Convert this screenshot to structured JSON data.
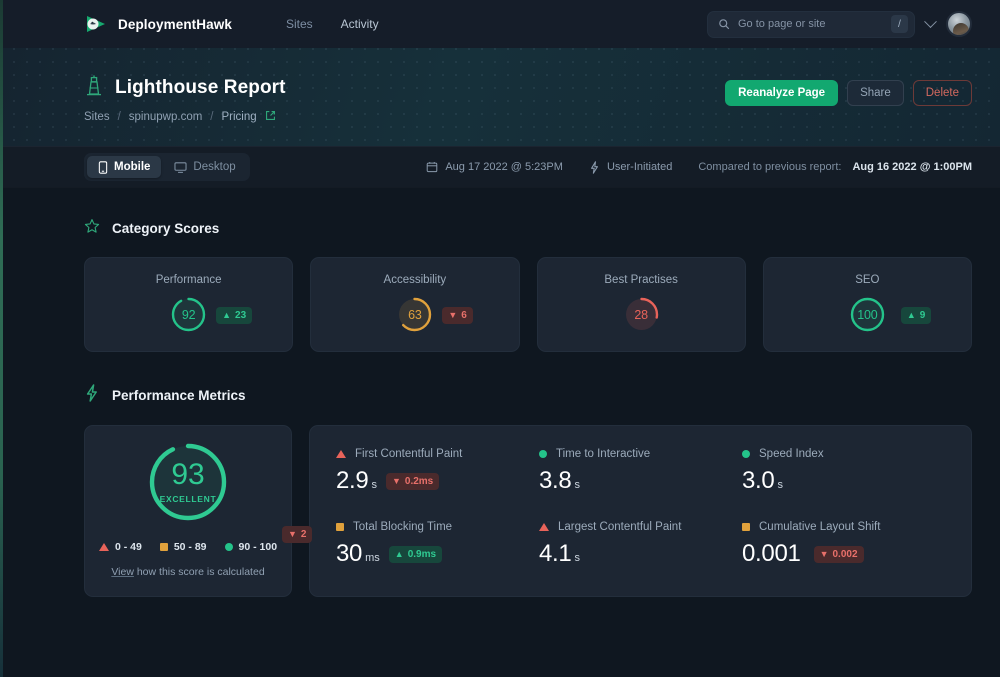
{
  "brand": {
    "name": "DeploymentHawk",
    "logo_icon": "hawk-logo-icon"
  },
  "nav": {
    "items": [
      {
        "label": "Sites"
      },
      {
        "label": "Activity"
      }
    ]
  },
  "search": {
    "placeholder": "Go to page or site",
    "shortcut": "/",
    "icon": "search-icon"
  },
  "account": {
    "chevron_icon": "chevron-down-icon",
    "avatar_icon": "user-avatar"
  },
  "hero": {
    "icon": "lighthouse-icon",
    "title": "Lighthouse Report",
    "breadcrumb": {
      "root": "Sites",
      "site": "spinupwp.com",
      "page": "Pricing",
      "sep": "/",
      "external_icon": "external-link-icon"
    },
    "actions": {
      "reanalyze": "Reanalyze Page",
      "share": "Share",
      "delete": "Delete"
    }
  },
  "toolbar": {
    "devices": [
      {
        "label": "Mobile",
        "icon": "mobile-icon",
        "active": true
      },
      {
        "label": "Desktop",
        "icon": "desktop-icon",
        "active": false
      }
    ],
    "date": "Aug 17 2022 @ 5:23PM",
    "date_icon": "calendar-icon",
    "trigger": "User-Initiated",
    "trigger_icon": "bolt-icon",
    "compare_label": "Compared to previous report:",
    "compare_date": "Aug 16 2022 @ 1:00PM"
  },
  "category_scores": {
    "heading": "Category Scores",
    "heading_icon": "star-icon",
    "cards": [
      {
        "label": "Performance",
        "score": 92,
        "color": "#24c38a",
        "delta": 23,
        "delta_dir": "up"
      },
      {
        "label": "Accessibility",
        "score": 63,
        "color": "#e0a13c",
        "delta": 6,
        "delta_dir": "down"
      },
      {
        "label": "Best Practises",
        "score": 28,
        "color": "#e8635a",
        "delta": null,
        "delta_dir": null
      },
      {
        "label": "SEO",
        "score": 100,
        "color": "#24c38a",
        "delta": 9,
        "delta_dir": "up"
      }
    ]
  },
  "performance_metrics": {
    "heading": "Performance Metrics",
    "heading_icon": "bolt-icon",
    "score": {
      "value": 93,
      "rating": "EXCELLENT",
      "color": "#2fca92",
      "delta": 2,
      "delta_dir": "down",
      "legend": [
        {
          "label": "0 - 49",
          "shape": "triangle",
          "color": "#e8635a"
        },
        {
          "label": "50 - 89",
          "shape": "square",
          "color": "#e0a13c"
        },
        {
          "label": "90 - 100",
          "shape": "circle",
          "color": "#24c38a"
        }
      ],
      "calc_link_underlined": "View",
      "calc_link_rest": "how this score is calculated"
    },
    "metrics": [
      {
        "name": "First Contentful Paint",
        "shape": "triangle",
        "color": "#e8635a",
        "value": "2.9",
        "unit": "s",
        "delta": "0.2ms",
        "delta_dir": "down"
      },
      {
        "name": "Time to Interactive",
        "shape": "circle",
        "color": "#24c38a",
        "value": "3.8",
        "unit": "s",
        "delta": null,
        "delta_dir": null
      },
      {
        "name": "Speed Index",
        "shape": "circle",
        "color": "#24c38a",
        "value": "3.0",
        "unit": "s",
        "delta": null,
        "delta_dir": null
      },
      {
        "name": "Total Blocking Time",
        "shape": "square",
        "color": "#e0a13c",
        "value": "30",
        "unit": "ms",
        "delta": "0.9ms",
        "delta_dir": "up"
      },
      {
        "name": "Largest Contentful Paint",
        "shape": "triangle",
        "color": "#e8635a",
        "value": "4.1",
        "unit": "s",
        "delta": null,
        "delta_dir": null
      },
      {
        "name": "Cumulative Layout Shift",
        "shape": "square",
        "color": "#e0a13c",
        "value": "0.001",
        "unit": "",
        "delta": "0.002",
        "delta_dir": "down"
      }
    ]
  }
}
